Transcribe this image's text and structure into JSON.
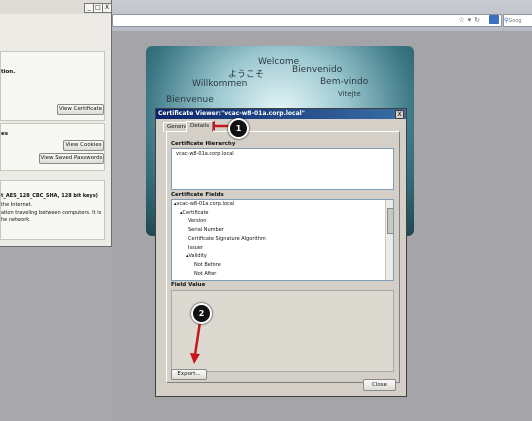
{
  "browser": {
    "search_placeholder": "Goog",
    "toolbar_icons": [
      "star-icon",
      "dropdown-icon",
      "refresh-icon"
    ]
  },
  "page_info": {
    "window_buttons": [
      "_",
      "□",
      "X"
    ],
    "identity_text": "tion.",
    "view_certificate": "View Certificate",
    "privacy_text": "es",
    "view_cookies": "View Cookies",
    "view_saved_passwords": "View Saved Passwords",
    "cipher_text": "t_AES_128_CBC_SHA, 128 bit keys)",
    "cipher_desc_1": "the Internet.",
    "cipher_desc_2": "ation traveling between computers. It is",
    "cipher_desc_3": "he network."
  },
  "welcome": {
    "words": [
      "Welcome",
      "ようこそ",
      "Bienvenido",
      "Willkommen",
      "Bem-vindo",
      "Bienvenue",
      "Vitejte"
    ]
  },
  "dialog": {
    "title": "Certificate Viewer:\"vcac-w8-01a.corp.local\"",
    "close_x": "X",
    "tabs": [
      "General",
      "Details"
    ],
    "hierarchy_label": "Certificate Hierarchy",
    "hierarchy_items": [
      "vcac-w8-01a.corp.local"
    ],
    "fields_label": "Certificate Fields",
    "fields": [
      "▴vcac-w8-01a.corp.local",
      "▴Certificate",
      "Version",
      "Serial Number",
      "Certificate Signature Algorithm",
      "Issuer",
      "▴Validity",
      "Not Before",
      "Not After"
    ],
    "value_label": "Field Value",
    "export_button": "Export...",
    "close_button": "Close"
  },
  "callouts": [
    "1",
    "2"
  ],
  "colors": {
    "dialog_title_start": "#0a246a",
    "dialog_title_end": "#3a6ea5",
    "arrow_red": "#c4161c"
  }
}
